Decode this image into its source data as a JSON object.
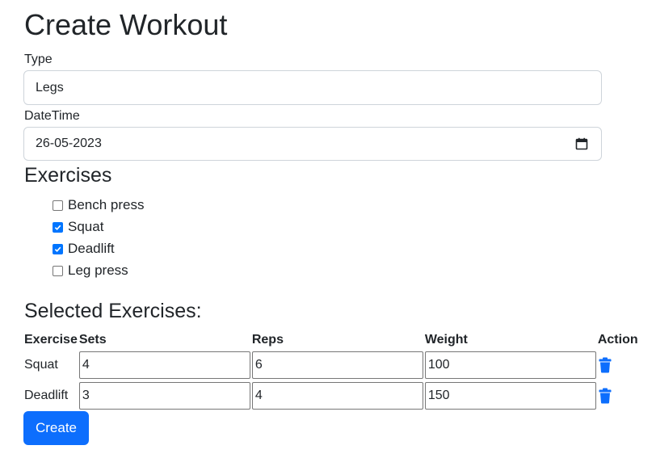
{
  "page": {
    "title": "Create Workout"
  },
  "form": {
    "type_label": "Type",
    "type_value": "Legs",
    "datetime_label": "DateTime",
    "datetime_value": "26-05-2023"
  },
  "exercises": {
    "title": "Exercises",
    "options": [
      {
        "label": "Bench press",
        "checked": false
      },
      {
        "label": "Squat",
        "checked": true
      },
      {
        "label": "Deadlift",
        "checked": true
      },
      {
        "label": "Leg press",
        "checked": false
      }
    ]
  },
  "selected": {
    "title": "Selected Exercises:",
    "headers": [
      "Exercise",
      "Sets",
      "Reps",
      "Weight",
      "Action"
    ],
    "rows": [
      {
        "exercise": "Squat",
        "sets": "4",
        "reps": "6",
        "weight": "100",
        "action_icon": "trash-icon"
      },
      {
        "exercise": "Deadlift",
        "sets": "3",
        "reps": "4",
        "weight": "150",
        "action_icon": "trash-icon"
      }
    ]
  },
  "actions": {
    "create_label": "Create"
  },
  "colors": {
    "primary": "#0d6efd",
    "checkbox_accent": "#0075ff",
    "text": "#212529",
    "input_border": "#ced4da"
  }
}
